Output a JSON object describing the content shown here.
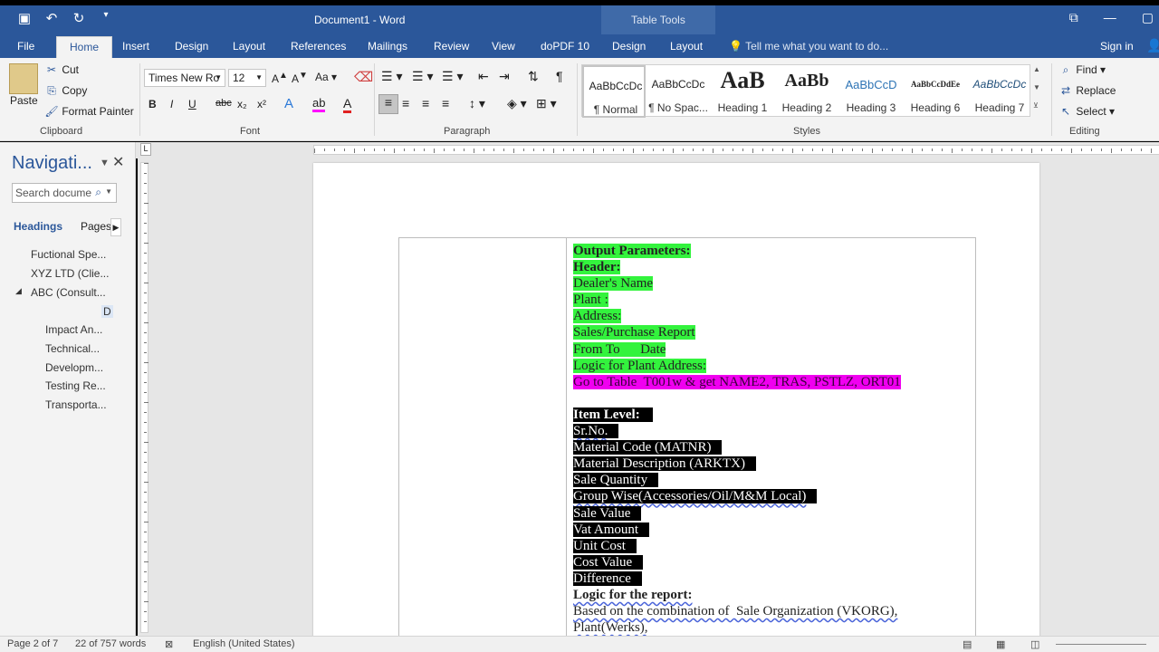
{
  "window": {
    "doc_title": "Document1 - Word",
    "context_title": "Table Tools",
    "accent": "#2b579a"
  },
  "qat": [
    "save-icon",
    "undo-icon",
    "redo-icon",
    "customize-icon"
  ],
  "tabs": [
    {
      "label": "File"
    },
    {
      "label": "Home"
    },
    {
      "label": "Insert"
    },
    {
      "label": "Design"
    },
    {
      "label": "Layout"
    },
    {
      "label": "References"
    },
    {
      "label": "Mailings"
    },
    {
      "label": "Review"
    },
    {
      "label": "View"
    },
    {
      "label": "doPDF 10"
    },
    {
      "label": "Design"
    },
    {
      "label": "Layout"
    }
  ],
  "tell_me": "Tell me what you want to do...",
  "sign_in": "Sign in",
  "clipboard": {
    "paste": "Paste",
    "cut": "Cut",
    "copy": "Copy",
    "format_painter": "Format Painter",
    "label": "Clipboard"
  },
  "font": {
    "name": "Times New Ro",
    "size": "12",
    "label": "Font",
    "buttons": [
      "B",
      "I",
      "U",
      "abc",
      "x₂",
      "x²"
    ]
  },
  "paragraph": {
    "label": "Paragraph"
  },
  "styles": {
    "label": "Styles",
    "items": [
      {
        "preview": "AaBbCcDc",
        "name": "¶ Normal"
      },
      {
        "preview": "AaBbCcDc",
        "name": "¶ No Spac..."
      },
      {
        "preview": "AaB",
        "name": "Heading 1"
      },
      {
        "preview": "AaBb",
        "name": "Heading 2"
      },
      {
        "preview": "AaBbCcD",
        "name": "Heading 3"
      },
      {
        "preview": "AaBbCcDdEe",
        "name": "Heading 6"
      },
      {
        "preview": "AaBbCcDc",
        "name": "Heading 7"
      }
    ]
  },
  "editing": {
    "find": "Find",
    "replace": "Replace",
    "select": "Select",
    "label": "Editing"
  },
  "nav": {
    "title": "Navigati...",
    "search_placeholder": "Search docume",
    "tab_headings": "Headings",
    "tab_pages": "Pages",
    "items": [
      "Fuctional Spe...",
      "XYZ LTD (Clie...",
      "ABC (Consult...",
      "D",
      "Impact An...",
      "Technical...",
      "Developm...",
      "Testing Re...",
      "Transporta..."
    ]
  },
  "document": {
    "green_lines": [
      "Output Parameters:",
      "Header:",
      "Dealer's Name",
      "Plant :",
      "Address:",
      "Sales/Purchase Report",
      "From To      Date",
      "Logic for Plant Address:"
    ],
    "magenta_line": "Go to Table  T001w & get NAME2, TRAS, PSTLZ, ORT01",
    "black_lines": [
      "Item Level:",
      "Sr.No.",
      "Material Code (MATNR)",
      "Material Description (ARKTX)",
      "Sale Quantity",
      "Group Wise(Accessories/Oil/M&M Local)",
      "Sale Value",
      "Vat Amount",
      "Unit Cost",
      "Cost Value",
      "Difference"
    ],
    "logic_title": "Logic for the report:",
    "logic_lines": [
      "Based on the combination of  Sale Organization (VKORG),",
      "Plant(Werks),"
    ]
  },
  "status": {
    "page": "Page 2 of 7",
    "words": "22 of 757 words",
    "language": "English (United States)"
  },
  "colors": {
    "highlight_green": "#33f33d",
    "highlight_magenta": "#f000f0",
    "highlight_black": "#000000"
  }
}
